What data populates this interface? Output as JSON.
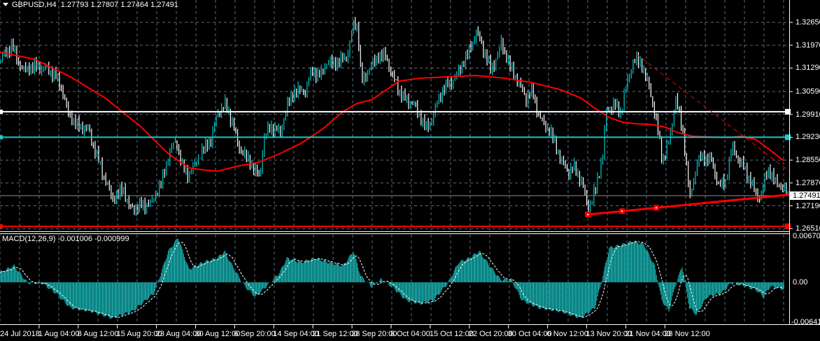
{
  "header": {
    "symbol": "GBPUSD,H4",
    "ohlc": "1.27793 1.27807 1.27464 1.27491"
  },
  "macd_header": {
    "label": "MACD(12,26,9)",
    "values": "-0.001006 -0.000999"
  },
  "colors": {
    "bull": "#00c8c8",
    "bear": "#ffffff",
    "ma": "#ff0000",
    "grid": "#5c6b7a",
    "macd": "#1ab5b5",
    "level_white": "#ffffff",
    "level_cyan": "#1ec8c8",
    "level_red": "#ff0000"
  },
  "chart_data": [
    {
      "type": "candlestick",
      "title": "GBPUSD,H4",
      "ylim": [
        1.2645,
        1.3325
      ],
      "price_ticks": [
        "1.32650",
        "1.31970",
        "1.31290",
        "1.30590",
        "1.29910",
        "1.29230",
        "1.28550",
        "1.27870",
        "1.27190",
        "1.26510"
      ],
      "current_price": "1.27491",
      "x_tick_labels": [
        "24 Jul 2018",
        "1 Aug 04:00",
        "8 Aug 12:00",
        "15 Aug 20:00",
        "23 Aug 04:00",
        "30 Aug 12:00",
        "6 Sep 20:00",
        "14 Sep 04:00",
        "21 Sep 12:00",
        "28 Sep 20:00",
        "8 Oct 04:00",
        "15 Oct 12:00",
        "22 Oct 20:00",
        "30 Oct 04:00",
        "6 Nov 12:00",
        "13 Nov 20:00",
        "21 Nov 04:00",
        "28 Nov 12:00"
      ],
      "price_path": [
        [
          0,
          1.3155
        ],
        [
          12,
          1.3196
        ],
        [
          24,
          1.3124
        ],
        [
          39,
          1.3134
        ],
        [
          55,
          1.3124
        ],
        [
          67,
          1.3082
        ],
        [
          75,
          1.2999
        ],
        [
          86,
          1.2957
        ],
        [
          98,
          1.2947
        ],
        [
          106,
          1.2884
        ],
        [
          118,
          1.2791
        ],
        [
          126,
          1.2739
        ],
        [
          138,
          1.277
        ],
        [
          145,
          1.2708
        ],
        [
          157,
          1.2718
        ],
        [
          169,
          1.2728
        ],
        [
          181,
          1.2791
        ],
        [
          189,
          1.2874
        ],
        [
          197,
          1.2916
        ],
        [
          204,
          1.2832
        ],
        [
          212,
          1.2812
        ],
        [
          224,
          1.2874
        ],
        [
          236,
          1.2916
        ],
        [
          244,
          1.2999
        ],
        [
          252,
          1.302
        ],
        [
          259,
          1.2978
        ],
        [
          267,
          1.2895
        ],
        [
          279,
          1.2853
        ],
        [
          291,
          1.2801
        ],
        [
          295,
          1.2916
        ],
        [
          303,
          1.2957
        ],
        [
          314,
          1.2936
        ],
        [
          322,
          1.302
        ],
        [
          330,
          1.3061
        ],
        [
          342,
          1.3061
        ],
        [
          350,
          1.3124
        ],
        [
          358,
          1.3103
        ],
        [
          365,
          1.3144
        ],
        [
          377,
          1.3144
        ],
        [
          389,
          1.3165
        ],
        [
          397,
          1.3269
        ],
        [
          401,
          1.3248
        ],
        [
          405,
          1.3082
        ],
        [
          413,
          1.3124
        ],
        [
          424,
          1.3165
        ],
        [
          432,
          1.3165
        ],
        [
          440,
          1.3103
        ],
        [
          452,
          1.304
        ],
        [
          464,
          1.302
        ],
        [
          472,
          1.2978
        ],
        [
          479,
          1.2947
        ],
        [
          487,
          1.2999
        ],
        [
          495,
          1.3061
        ],
        [
          503,
          1.3082
        ],
        [
          511,
          1.3103
        ],
        [
          519,
          1.3144
        ],
        [
          527,
          1.3186
        ],
        [
          534,
          1.3238
        ],
        [
          542,
          1.3186
        ],
        [
          550,
          1.3124
        ],
        [
          558,
          1.3165
        ],
        [
          562,
          1.3207
        ],
        [
          570,
          1.3144
        ],
        [
          582,
          1.3082
        ],
        [
          590,
          1.304
        ],
        [
          597,
          1.3061
        ],
        [
          605,
          1.2978
        ],
        [
          613,
          1.2957
        ],
        [
          621,
          1.2916
        ],
        [
          629,
          1.2853
        ],
        [
          637,
          1.2822
        ],
        [
          645,
          1.2832
        ],
        [
          652,
          1.2791
        ],
        [
          660,
          1.2708
        ],
        [
          668,
          1.277
        ],
        [
          676,
          1.2874
        ],
        [
          680,
          1.2999
        ],
        [
          688,
          1.302
        ],
        [
          696,
          1.2999
        ],
        [
          703,
          1.3082
        ],
        [
          711,
          1.3155
        ],
        [
          719,
          1.3144
        ],
        [
          727,
          1.3082
        ],
        [
          735,
          1.2988
        ],
        [
          743,
          1.2853
        ],
        [
          751,
          1.2916
        ],
        [
          758,
          1.304
        ],
        [
          766,
          1.2936
        ],
        [
          774,
          1.2739
        ],
        [
          782,
          1.2853
        ],
        [
          790,
          1.2864
        ],
        [
          798,
          1.2853
        ],
        [
          806,
          1.278
        ],
        [
          814,
          1.2791
        ],
        [
          821,
          1.2895
        ],
        [
          829,
          1.2853
        ],
        [
          837,
          1.2822
        ],
        [
          845,
          1.277
        ],
        [
          853,
          1.2739
        ],
        [
          861,
          1.2832
        ],
        [
          869,
          1.2791
        ],
        [
          876,
          1.278
        ],
        [
          884,
          1.2749
        ]
      ],
      "moving_average": [
        [
          0,
          1.3176
        ],
        [
          39,
          1.3155
        ],
        [
          79,
          1.3103
        ],
        [
          118,
          1.304
        ],
        [
          157,
          1.2957
        ],
        [
          189,
          1.2874
        ],
        [
          212,
          1.2832
        ],
        [
          228,
          1.2826
        ],
        [
          244,
          1.2822
        ],
        [
          267,
          1.2837
        ],
        [
          291,
          1.2849
        ],
        [
          314,
          1.2874
        ],
        [
          338,
          1.2905
        ],
        [
          362,
          1.2947
        ],
        [
          385,
          1.2999
        ],
        [
          401,
          1.3024
        ],
        [
          417,
          1.3034
        ],
        [
          432,
          1.3061
        ],
        [
          448,
          1.309
        ],
        [
          472,
          1.3099
        ],
        [
          503,
          1.3103
        ],
        [
          534,
          1.3107
        ],
        [
          550,
          1.3103
        ],
        [
          566,
          1.3099
        ],
        [
          597,
          1.3086
        ],
        [
          629,
          1.3065
        ],
        [
          652,
          1.304
        ],
        [
          668,
          1.3009
        ],
        [
          684,
          1.2982
        ],
        [
          700,
          1.2967
        ],
        [
          715,
          1.2963
        ],
        [
          731,
          1.2961
        ],
        [
          747,
          1.2953
        ],
        [
          762,
          1.2936
        ],
        [
          778,
          1.2926
        ],
        [
          794,
          1.2924
        ],
        [
          817,
          1.2922
        ],
        [
          833,
          1.2926
        ],
        [
          849,
          1.2916
        ],
        [
          865,
          1.2884
        ],
        [
          880,
          1.2853
        ]
      ],
      "levels": [
        {
          "price": 1.2999,
          "color": "white"
        },
        {
          "price": 1.2923,
          "color": "cyan"
        },
        {
          "price": 1.2658,
          "color": "red"
        }
      ],
      "trendline": {
        "from": [
          660,
          1.2693
        ],
        "to": [
          886,
          1.2752
        ]
      },
      "dashed_trendline": {
        "from": [
          714,
          1.3171
        ],
        "to": [
          886,
          1.2822
        ]
      }
    },
    {
      "type": "histogram",
      "title": "MACD(12,26,9)",
      "ylim": [
        -0.006411,
        0.006705
      ],
      "ticks": [
        "0.006705",
        "0.00",
        "-0.006411"
      ],
      "histogram": [
        [
          0,
          0.0014
        ],
        [
          16,
          0.0024
        ],
        [
          31,
          -0.0001
        ],
        [
          47,
          -0.0001
        ],
        [
          63,
          -0.0016
        ],
        [
          79,
          -0.0037
        ],
        [
          102,
          -0.0042
        ],
        [
          126,
          -0.0052
        ],
        [
          149,
          -0.0042
        ],
        [
          173,
          -0.0016
        ],
        [
          189,
          0.0045
        ],
        [
          200,
          0.0065
        ],
        [
          212,
          0.0019
        ],
        [
          228,
          0.0029
        ],
        [
          244,
          0.0035
        ],
        [
          252,
          0.0045
        ],
        [
          263,
          0.0019
        ],
        [
          275,
          -0.0006
        ],
        [
          287,
          -0.0021
        ],
        [
          299,
          -0.0006
        ],
        [
          314,
          0.0014
        ],
        [
          322,
          0.0035
        ],
        [
          338,
          0.0029
        ],
        [
          354,
          0.0035
        ],
        [
          369,
          0.0029
        ],
        [
          385,
          0.0024
        ],
        [
          397,
          0.0045
        ],
        [
          405,
          0.0009
        ],
        [
          417,
          -0.0006
        ],
        [
          428,
          0.0004
        ],
        [
          440,
          -0.0006
        ],
        [
          456,
          -0.0026
        ],
        [
          472,
          -0.0031
        ],
        [
          487,
          -0.0026
        ],
        [
          503,
          -0.0001
        ],
        [
          515,
          0.0029
        ],
        [
          527,
          0.0035
        ],
        [
          538,
          0.0045
        ],
        [
          550,
          0.0024
        ],
        [
          562,
          0.0004
        ],
        [
          574,
          0.0004
        ],
        [
          586,
          -0.0026
        ],
        [
          605,
          -0.0037
        ],
        [
          629,
          -0.0042
        ],
        [
          652,
          -0.0052
        ],
        [
          668,
          -0.0037
        ],
        [
          676,
          0.0004
        ],
        [
          684,
          0.005
        ],
        [
          700,
          0.0055
        ],
        [
          711,
          0.006
        ],
        [
          723,
          0.0055
        ],
        [
          735,
          0.0024
        ],
        [
          743,
          -0.0026
        ],
        [
          751,
          -0.0042
        ],
        [
          758,
          -0.0006
        ],
        [
          766,
          0.0024
        ],
        [
          774,
          -0.0037
        ],
        [
          782,
          -0.0047
        ],
        [
          794,
          -0.0021
        ],
        [
          810,
          -0.0016
        ],
        [
          821,
          -0.0001
        ],
        [
          833,
          -0.0004
        ],
        [
          849,
          -0.0011
        ],
        [
          857,
          -0.0021
        ],
        [
          865,
          -0.0006
        ],
        [
          880,
          -0.001
        ]
      ]
    }
  ]
}
